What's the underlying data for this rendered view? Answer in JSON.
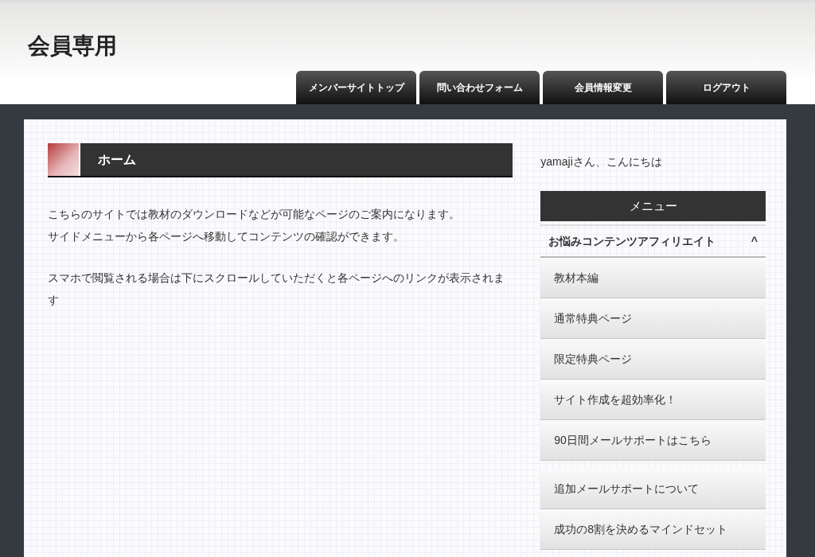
{
  "site_title": "会員専用",
  "nav_tabs": [
    {
      "label": "メンバーサイトトップ"
    },
    {
      "label": "問い合わせフォーム"
    },
    {
      "label": "会員情報変更"
    },
    {
      "label": "ログアウト"
    }
  ],
  "main": {
    "heading": "ホーム",
    "paragraphs": [
      {
        "lines": [
          "こちらのサイトでは教材のダウンロードなどが可能なページのご案内になります。",
          "サイドメニューから各ページへ移動してコンテンツの確認ができます。"
        ]
      },
      {
        "lines": [
          "スマホで閲覧される場合は下にスクロールしていただくと各ページへのリンクが表示されます"
        ]
      }
    ]
  },
  "sidebar": {
    "greeting": "yamajiさん、こんにちは",
    "menu_title": "メニュー",
    "group": {
      "title": "お悩みコンテンツアフィリエイト",
      "expanded": true,
      "caret": "^",
      "items": [
        "教材本編",
        "通常特典ページ",
        "限定特典ページ",
        "サイト作成を超効率化！",
        "90日間メールサポートはこちら"
      ]
    },
    "more_items": [
      "追加メールサポートについて",
      "成功の8割を決めるマインドセット"
    ]
  }
}
